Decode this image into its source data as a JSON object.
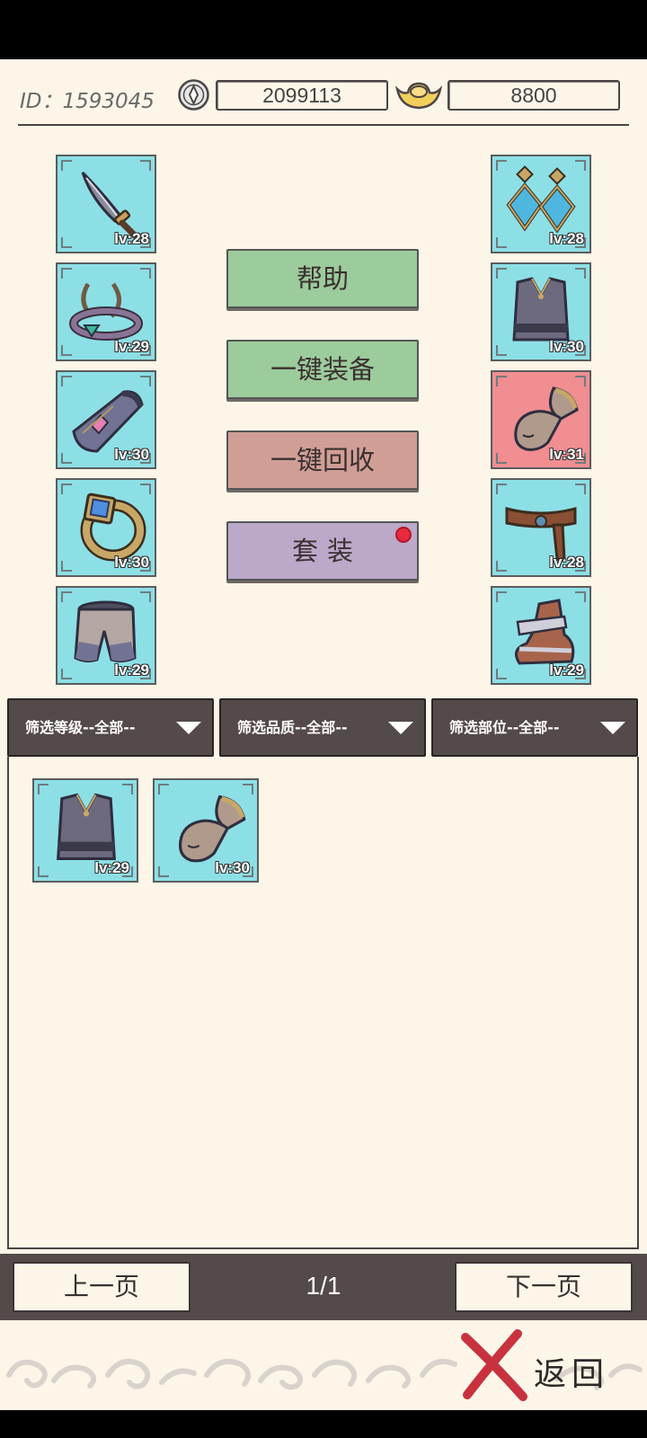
{
  "header": {
    "id_text": "ID：1593045",
    "silver_value": "2099113",
    "gold_value": "8800"
  },
  "equipment_left": [
    {
      "name": "sword",
      "icon": "sword-icon",
      "level": "lv:28"
    },
    {
      "name": "circlet",
      "icon": "circlet-icon",
      "level": "lv:29"
    },
    {
      "name": "bracer",
      "icon": "bracer-icon",
      "level": "lv:30"
    },
    {
      "name": "ring",
      "icon": "ring-icon",
      "level": "lv:30"
    },
    {
      "name": "pants",
      "icon": "pants-icon",
      "level": "lv:29"
    }
  ],
  "equipment_right": [
    {
      "name": "earrings",
      "icon": "earrings-icon",
      "level": "lv:28"
    },
    {
      "name": "vest",
      "icon": "vest-icon",
      "level": "lv:30"
    },
    {
      "name": "glove",
      "icon": "glove-icon",
      "level": "lv:31",
      "quality_color": "#f08e92"
    },
    {
      "name": "belt",
      "icon": "belt-icon",
      "level": "lv:28"
    },
    {
      "name": "boots",
      "icon": "boots-icon",
      "level": "lv:29"
    }
  ],
  "actions": {
    "help": "帮助",
    "equip_all": "一键装备",
    "recycle_all": "一键回收",
    "set": "套装"
  },
  "filters": {
    "level": "筛选等级--全部--",
    "quality": "筛选品质--全部--",
    "slot": "筛选部位--全部--"
  },
  "inventory": [
    {
      "icon": "vest-icon",
      "level": "lv:29"
    },
    {
      "icon": "glove-icon",
      "level": "lv:30"
    }
  ],
  "pager": {
    "prev": "上一页",
    "page": "1/1",
    "next": "下一页"
  },
  "footer": {
    "back": "返回"
  },
  "colors": {
    "slot_bg": "#8ddfe6",
    "slot_red": "#f08e92",
    "button_green": "#9ccb9c",
    "button_pink": "#d09e95",
    "button_purple": "#bca9c9",
    "dark_bar": "#554a4a",
    "page_bg": "#fdf6e8"
  }
}
